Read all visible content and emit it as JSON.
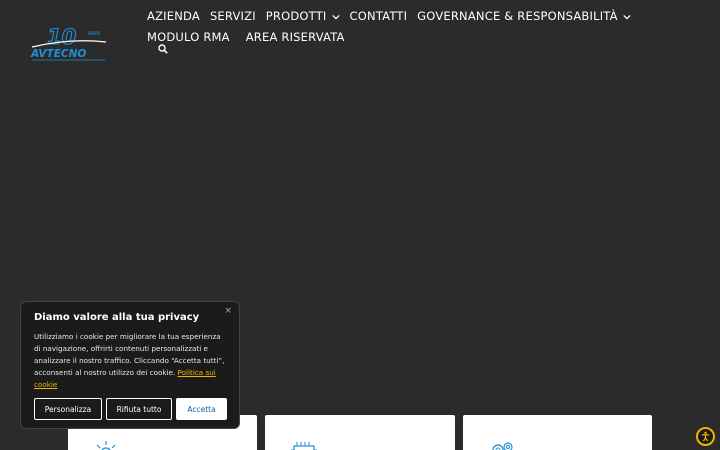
{
  "logo": {
    "anni_text": "ANNI",
    "brand_text": "AVTECNO"
  },
  "nav": {
    "items": [
      {
        "label": "AZIENDA"
      },
      {
        "label": "SERVIZI"
      },
      {
        "label": "PRODOTTI"
      },
      {
        "label": "CONTATTI"
      },
      {
        "label": "GOVERNANCE & RESPONSABILITÀ"
      },
      {
        "label": "MODULO RMA"
      },
      {
        "label": "AREA RISERVATA"
      }
    ]
  },
  "cookie": {
    "title": "Diamo valore alla tua privacy",
    "body": "Utilizziamo i cookie per migliorare la tua esperienza di navigazione, offrirti contenuti personalizzati e analizzare il nostro traffico. Cliccando “Accetta tutti”, acconsenti al nostro utilizzo dei cookie.",
    "link": "Politica sui cookie",
    "close": "×",
    "buttons": {
      "customize": "Personalizza",
      "reject": "Rifiuta tutto",
      "accept": "Accetta"
    }
  },
  "icons": {
    "search": "search-icon",
    "accessibility": "accessibility-icon",
    "card1": "lightbulb-icon",
    "card2": "chip-icon",
    "card3": "gears-icon"
  },
  "colors": {
    "background": "#2b2b2b",
    "accent": "#f4b400",
    "logo_blue": "#1f8fd6",
    "accept_text": "#1b5fa8"
  }
}
